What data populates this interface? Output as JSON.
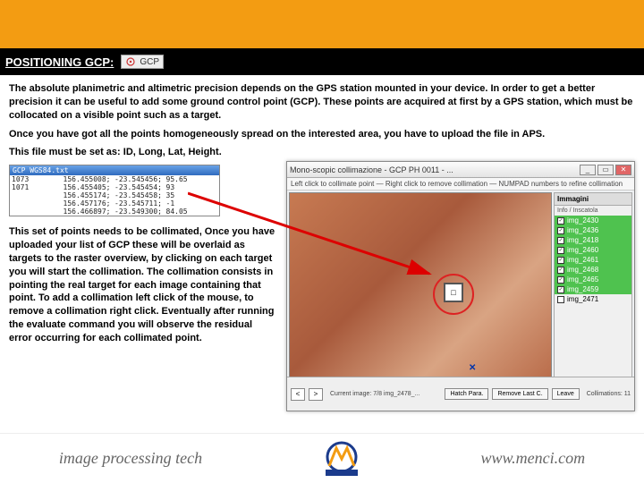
{
  "header": {
    "title": "POSITIONING GCP:",
    "badge_label": "GCP"
  },
  "body": {
    "p1": "The absolute planimetric and altimetric precision depends on the GPS station mounted in your device. In order to get a better precision it can be useful to add some ground control point (GCP). These points are acquired at first by a GPS station, which must be collocated on a visible point such as a target.",
    "p2": "Once you have got all the points homogeneously spread on the interested area, you have to upload the file in APS.",
    "p3": "This file must be set as: ID, Long, Lat, Height.",
    "side": "This set of points needs to be collimated, Once you have uploaded your list of GCP these will be overlaid as targets to the raster overview, by clicking on each target you will start the collimation. The collimation consists in pointing the real target for each image containing that point. To add a collimation left click of the mouse, to remove a collimation right click. Eventually after running the evaluate command you will observe the residual error occurring for each collimated point."
  },
  "gps_table": {
    "title": "GCP WGS84.txt",
    "rows": [
      {
        "id": "1073",
        "lon": "156.455008;",
        "lat": "-23.545456;",
        "h": "95.65"
      },
      {
        "id": "1071",
        "lon": "156.455405;",
        "lat": "-23.545454;",
        "h": "93"
      },
      {
        "id": "",
        "lon": "156.455174;",
        "lat": "-23.545458;",
        "h": "35"
      },
      {
        "id": "",
        "lon": "156.457176;",
        "lat": "-23.545711;",
        "h": "-1"
      },
      {
        "id": "",
        "lon": "156.466897;",
        "lat": "-23.549300;",
        "h": "84.05"
      }
    ]
  },
  "app": {
    "title": "Mono-scopic collimazione - GCP PH 0011 - ...",
    "infobar": "Left click to collimate point — Right click to remove collimation — NUMPAD numbers to refine collimation",
    "panel_head": "Immagini",
    "panel_sub": "Info / Inscatola",
    "items": [
      {
        "label": "img_2430",
        "done": true
      },
      {
        "label": "img_2436",
        "done": true
      },
      {
        "label": "img_2418",
        "done": true
      },
      {
        "label": "img_2460",
        "done": true
      },
      {
        "label": "img_2461",
        "done": true
      },
      {
        "label": "img_2468",
        "done": true
      },
      {
        "label": "img_2465",
        "done": true
      },
      {
        "label": "img_2459",
        "done": true
      },
      {
        "label": "img_2471",
        "done": false
      }
    ],
    "nav_prev": "<",
    "nav_next": ">",
    "status": "Current image: 7/8  img_2478_...",
    "btn_hatch": "Hatch Para.",
    "btn_remove": "Remove Last C.",
    "btn_leave": "Leave",
    "collim": "Collimations: 11",
    "target_inner": "□"
  },
  "footer": {
    "left": "image processing tech",
    "right": "www.menci.com"
  }
}
